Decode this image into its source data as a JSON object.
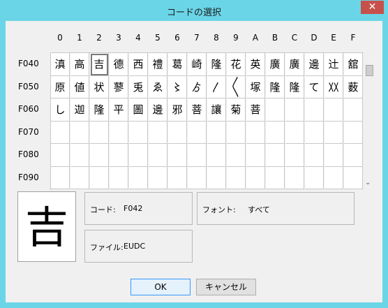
{
  "window": {
    "title": "コードの選択",
    "close_glyph": "✕"
  },
  "columns": [
    "0",
    "1",
    "2",
    "3",
    "4",
    "5",
    "6",
    "7",
    "8",
    "9",
    "A",
    "B",
    "C",
    "D",
    "E",
    "F"
  ],
  "rows": [
    {
      "code": "F040",
      "chars": [
        "滇",
        "高",
        "吉",
        "德",
        "西",
        "禮",
        "葛",
        "崎",
        "隆",
        "花",
        "英",
        "廣",
        "廣",
        "邊",
        "辻",
        "舘"
      ]
    },
    {
      "code": "F050",
      "chars": [
        "原",
        "値",
        "状",
        "蓼",
        "兎",
        "ゑ",
        "〻",
        "ゟ",
        "〳",
        "〱",
        "塚",
        "隆",
        "隆",
        "て",
        "〷",
        "薮"
      ]
    },
    {
      "code": "F060",
      "chars": [
        "し",
        "迦",
        "隆",
        "平",
        "圖",
        "邊",
        "邪",
        "菩",
        "讓",
        "菊",
        "菩",
        "",
        "",
        "",
        "",
        ""
      ]
    },
    {
      "code": "F070",
      "chars": [
        "",
        "",
        "",
        "",
        "",
        "",
        "",
        "",
        "",
        "",
        "",
        "",
        "",
        "",
        "",
        ""
      ]
    },
    {
      "code": "F080",
      "chars": [
        "",
        "",
        "",
        "",
        "",
        "",
        "",
        "",
        "",
        "",
        "",
        "",
        "",
        "",
        "",
        ""
      ]
    },
    {
      "code": "F090",
      "chars": [
        "",
        "",
        "",
        "",
        "",
        "",
        "",
        "",
        "",
        "",
        "",
        "",
        "",
        "",
        "",
        ""
      ]
    }
  ],
  "selected": {
    "row": 0,
    "col": 2
  },
  "preview_char": "吉",
  "info": {
    "code_label": "コード:",
    "code_value": "F042",
    "font_label": "フォント:",
    "font_value": "すべて",
    "file_label": "ファイル:",
    "file_value": "EUDC"
  },
  "buttons": {
    "ok": "OK",
    "cancel": "キャンセル"
  },
  "scroll_down_glyph": "⌄"
}
